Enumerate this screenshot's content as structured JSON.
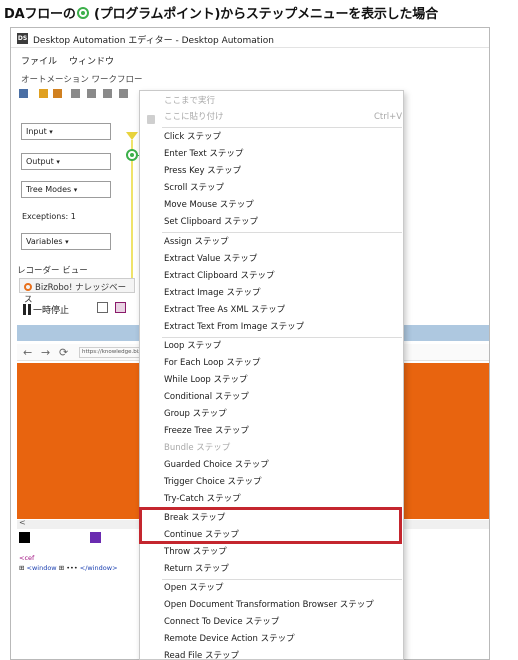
{
  "heading": {
    "before": "DAフローの",
    "after": " (プログラムポイント)からステップメニューを表示した場合"
  },
  "window": {
    "title": "Desktop Automation エディター - Desktop Automation",
    "menu": [
      "ファイル",
      "ウィンドウ"
    ],
    "workflow_label": "オートメーション ワークフロー"
  },
  "left_panel": {
    "input": "Input",
    "output": "Output",
    "tree_modes": "Tree Modes",
    "exceptions": "Exceptions: 1",
    "variables": "Variables"
  },
  "recorder": {
    "view_label": "レコーダー ビュー",
    "tab_label": "BizRobo! ナレッジベース",
    "pause_label": "一時停止",
    "url": "https://knowledge.bizro",
    "dom_line1": "<cef",
    "dom_line2_tag": "<window",
    "dom_line2_rest": "</window>"
  },
  "context_menu": {
    "run_to_here": "ここまで実行",
    "paste_here": "ここに貼り付け",
    "paste_shortcut": "Ctrl+V",
    "items": [
      "Click ステップ",
      "Enter Text ステップ",
      "Press Key ステップ",
      "Scroll ステップ",
      "Move Mouse ステップ",
      "Set Clipboard ステップ",
      "Assign ステップ",
      "Extract Value ステップ",
      "Extract Clipboard ステップ",
      "Extract Image ステップ",
      "Extract Tree As XML ステップ",
      "Extract Text From Image ステップ",
      "Loop ステップ",
      "For Each Loop ステップ",
      "While Loop ステップ",
      "Conditional ステップ",
      "Group ステップ",
      "Freeze Tree ステップ",
      "Bundle ステップ",
      "Guarded Choice ステップ",
      "Trigger Choice ステップ",
      "Try-Catch ステップ",
      "Break ステップ",
      "Continue ステップ",
      "Throw ステップ",
      "Return ステップ",
      "Open ステップ",
      "Open Document Transformation Browser ステップ",
      "Connect To Device ステップ",
      "Remote Device Action ステップ",
      "Read File ステップ"
    ]
  },
  "colors": {
    "highlight": "#c4262e",
    "browser_orange": "#e8640f",
    "program_point": "#3cb04a"
  }
}
